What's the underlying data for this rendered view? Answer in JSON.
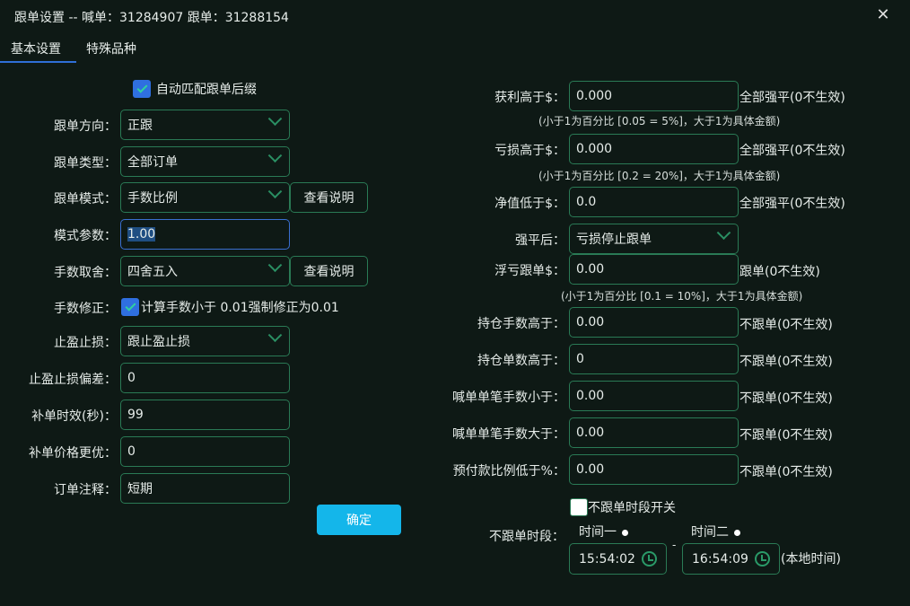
{
  "window": {
    "title": "跟单设置 -- 喊单：31284907 跟单：31288154",
    "close": "✕"
  },
  "tabs": [
    {
      "label": "基本设置"
    },
    {
      "label": "特殊品种"
    }
  ],
  "left": {
    "auto_match": "自动匹配跟单后缀",
    "rows": [
      {
        "label": "跟单方向：",
        "value": "正跟"
      },
      {
        "label": "跟单类型：",
        "value": "全部订单"
      },
      {
        "label": "跟单模式：",
        "value": "手数比例",
        "button": "查看说明"
      },
      {
        "label": "模式参数：",
        "value": "1.00"
      },
      {
        "label": "手数取舍：",
        "value": "四舍五入",
        "button": "查看说明"
      },
      {
        "label": "手数修正：",
        "value": "计算手数小于 0.01强制修正为0.01"
      },
      {
        "label": "止盈止损：",
        "value": "跟止盈止损"
      },
      {
        "label": "止盈止损偏差：",
        "value": "0"
      },
      {
        "label": "补单时效(秒)：",
        "value": "99"
      },
      {
        "label": "补单价格更优：",
        "value": "0"
      },
      {
        "label": "订单注释：",
        "value": "短期"
      }
    ],
    "confirm": "确定"
  },
  "right": {
    "rows": [
      {
        "label": "获利高于$：",
        "value": "0.000",
        "suffix": "全部强平(0不生效)",
        "hint": "(小于1为百分比 [0.05 = 5%]，大于1为具体金额)"
      },
      {
        "label": "亏损高于$：",
        "value": "0.000",
        "suffix": "全部强平(0不生效)",
        "hint": "(小于1为百分比 [0.2 = 20%]，大于1为具体金额)"
      },
      {
        "label": "净值低于$：",
        "value": "0.0",
        "suffix": "全部强平(0不生效)"
      },
      {
        "label": "强平后：",
        "value": "亏损停止跟单"
      },
      {
        "label": "浮亏跟单$：",
        "value": "0.00",
        "suffix": "跟单(0不生效)",
        "hint": "(小于1为百分比 [0.1 = 10%]，大于1为具体金额)"
      },
      {
        "label": "持仓手数高于：",
        "value": "0.00",
        "suffix": "不跟单(0不生效)"
      },
      {
        "label": "持仓单数高于：",
        "value": "0",
        "suffix": "不跟单(0不生效)"
      },
      {
        "label": "喊单单笔手数小于：",
        "value": "0.00",
        "suffix": "不跟单(0不生效)"
      },
      {
        "label": "喊单单笔手数大于：",
        "value": "0.00",
        "suffix": "不跟单(0不生效)"
      },
      {
        "label": "预付款比例低于%：",
        "value": "0.00",
        "suffix": "不跟单(0不生效)"
      }
    ],
    "period_switch": "不跟单时段开关",
    "period_label": "不跟单时段：",
    "time1_label": "时间一",
    "time2_label": "时间二",
    "time1": "15:54:02",
    "time2": "16:54:09",
    "dash": "-",
    "local": "(本地时间)"
  }
}
